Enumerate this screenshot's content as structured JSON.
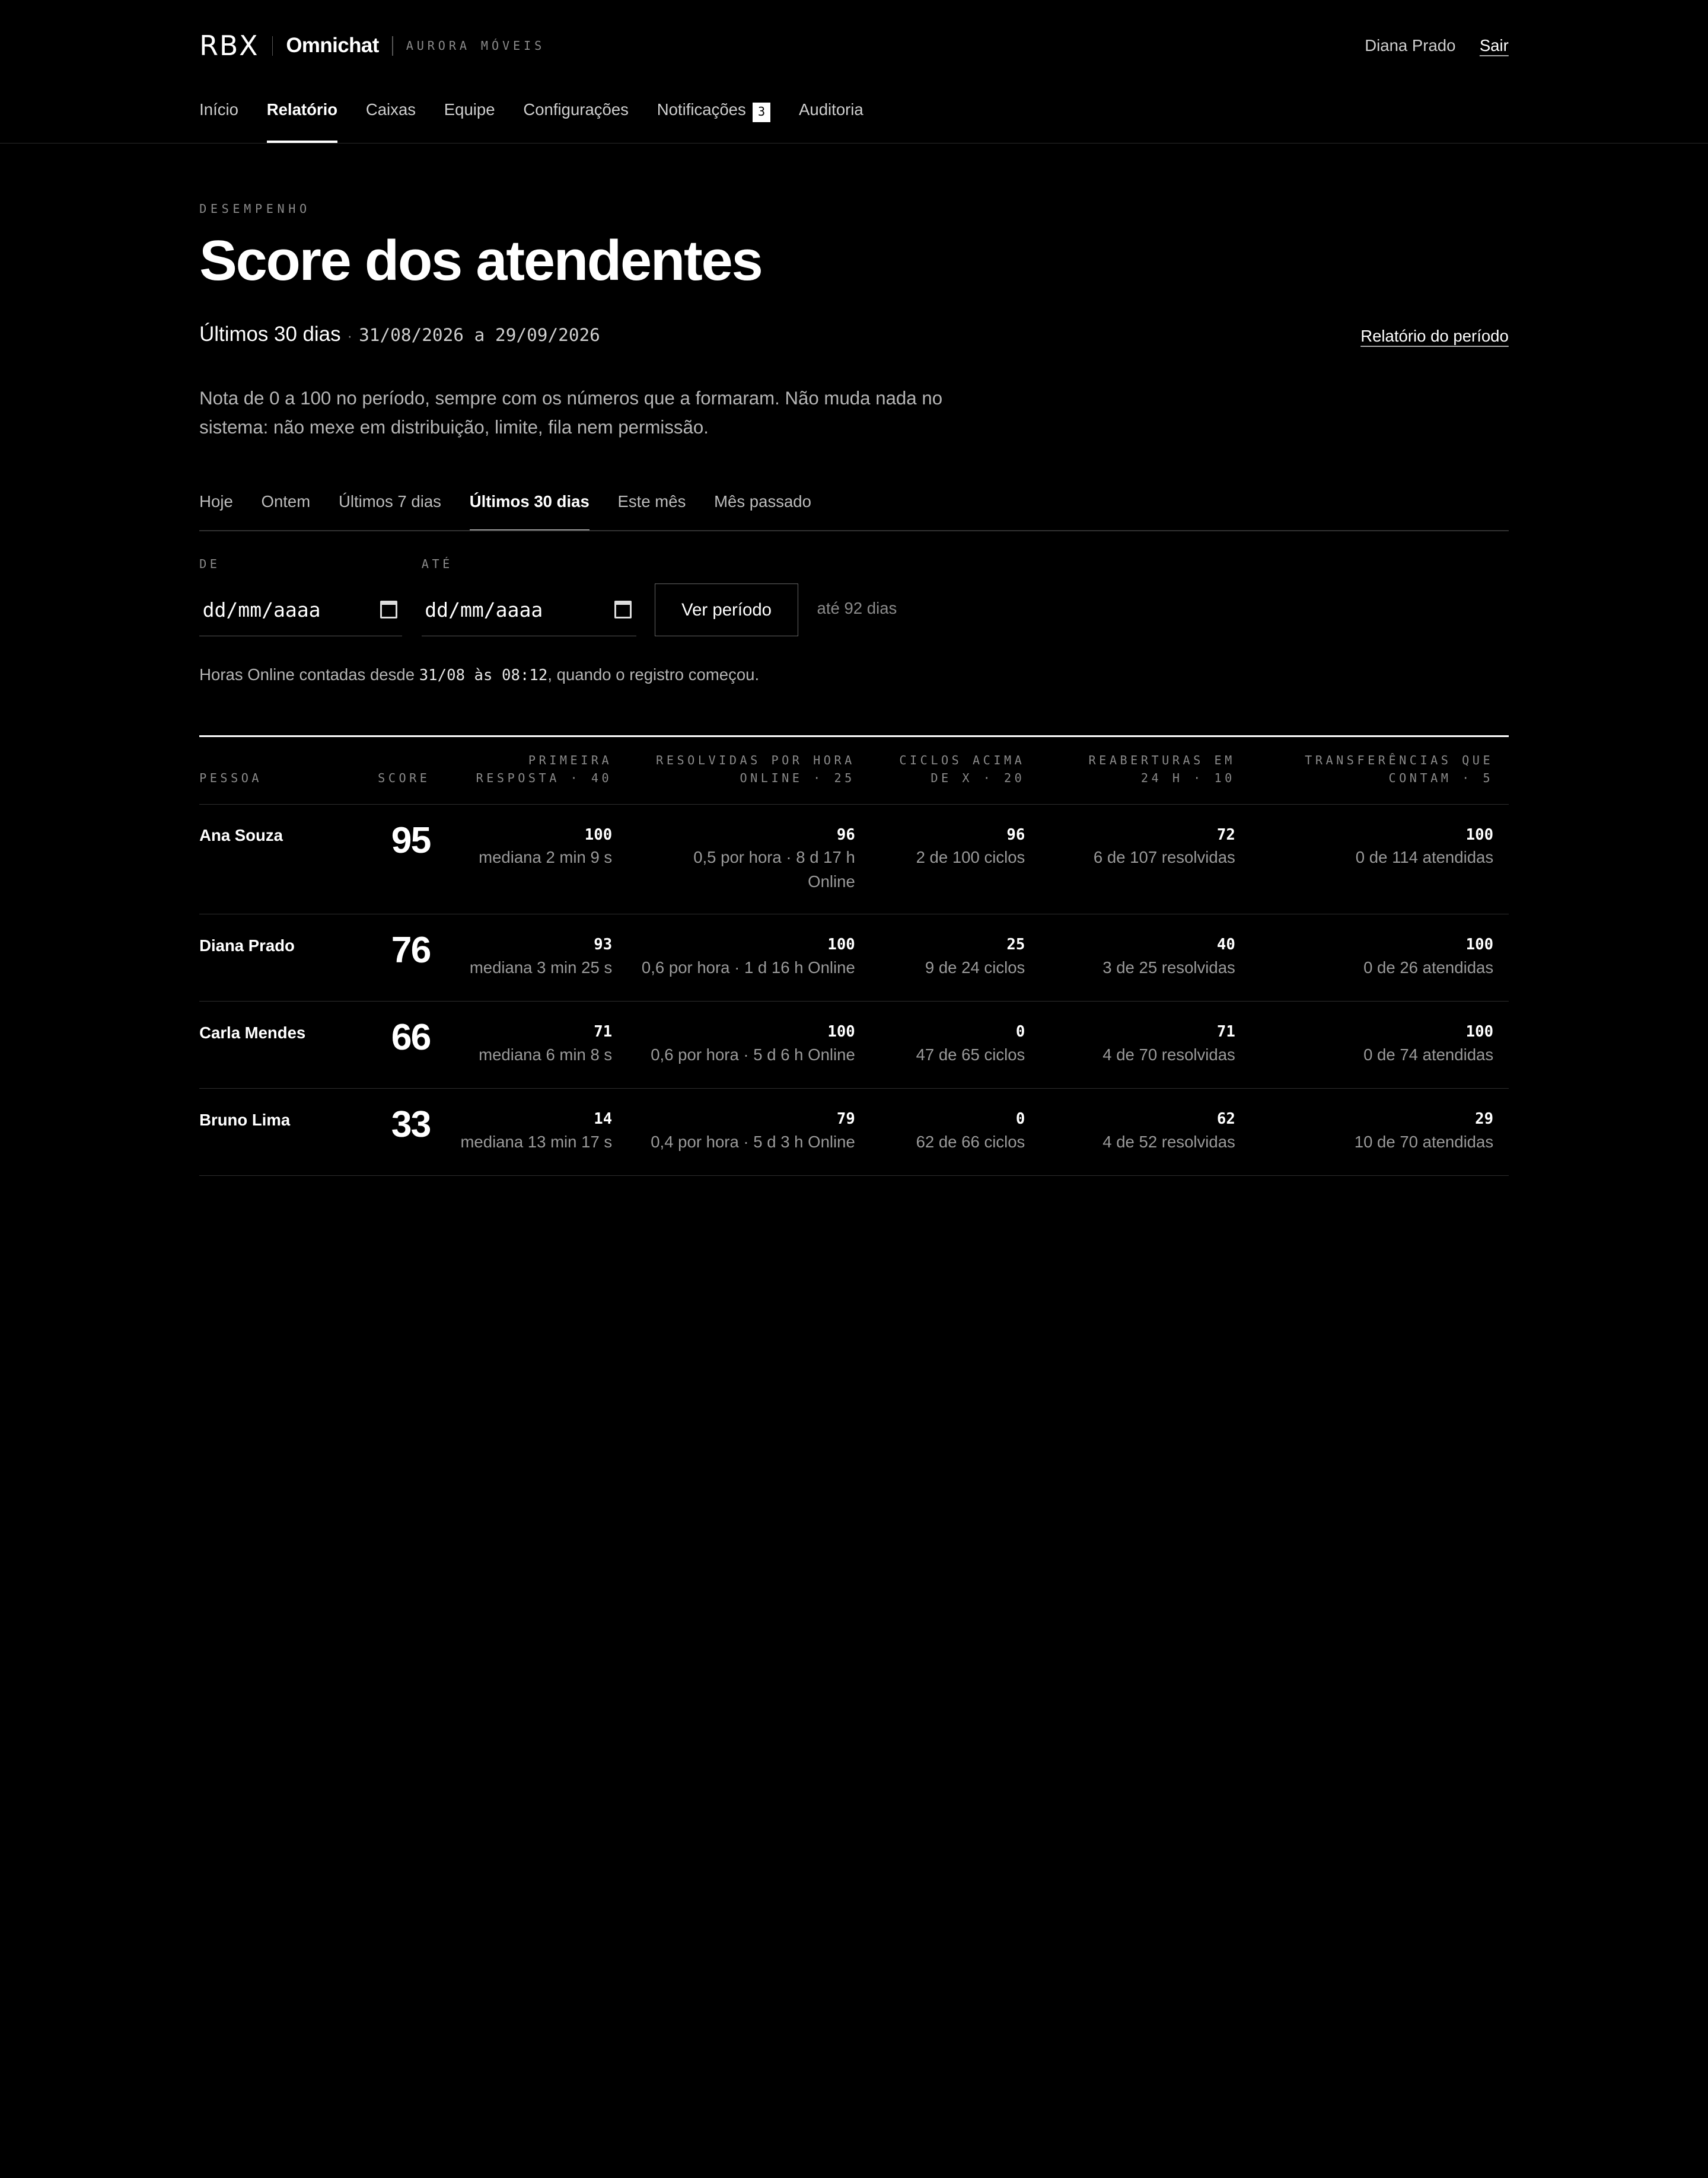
{
  "header": {
    "logo": "RBX",
    "product": "Omnichat",
    "company": "AURORA MÓVEIS",
    "user": "Diana Prado",
    "logout": "Sair"
  },
  "nav": [
    {
      "label": "Início"
    },
    {
      "label": "Relatório",
      "active": true
    },
    {
      "label": "Caixas"
    },
    {
      "label": "Equipe"
    },
    {
      "label": "Configurações"
    },
    {
      "label": "Notificações",
      "badge": "3"
    },
    {
      "label": "Auditoria"
    }
  ],
  "page": {
    "kicker": "DESEMPENHO",
    "title": "Score dos atendentes",
    "period_label": "Últimos 30 dias",
    "period_sep": "·",
    "period_range": "31/08/2026 a 29/09/2026",
    "report_link": "Relatório do período",
    "description": "Nota de 0 a 100 no período, sempre com os números que a formaram. Não muda nada no sistema: não mexe em distribuição, limite, fila nem permissão."
  },
  "range_tabs": [
    {
      "label": "Hoje"
    },
    {
      "label": "Ontem"
    },
    {
      "label": "Últimos 7 dias"
    },
    {
      "label": "Últimos 30 dias",
      "active": true
    },
    {
      "label": "Este mês"
    },
    {
      "label": "Mês passado"
    }
  ],
  "filters": {
    "from_label": "DE",
    "from_placeholder": "dd/mm/aaaa",
    "to_label": "ATÉ",
    "to_placeholder": "dd/mm/aaaa",
    "button": "Ver período",
    "hint": "até 92 dias"
  },
  "online_note": {
    "prefix": "Horas Online contadas desde ",
    "time": "31/08 às 08:12",
    "suffix": ", quando o registro começou."
  },
  "table": {
    "headers": {
      "person": "PESSOA",
      "score": "SCORE",
      "first_response": [
        "PRIMEIRA",
        "RESPOSTA · 40"
      ],
      "resolved": [
        "RESOLVIDAS POR HORA",
        "ONLINE · 25"
      ],
      "cycles": [
        "CICLOS ACIMA",
        "DE X · 20"
      ],
      "reopens": [
        "REABERTURAS EM",
        "24 H · 10"
      ],
      "transfers": [
        "TRANSFERÊNCIAS QUE",
        "CONTAM · 5"
      ]
    },
    "rows": [
      {
        "name": "Ana Souza",
        "score": "95",
        "first_response": {
          "value": "100",
          "detail": "mediana 2 min 9 s"
        },
        "resolved": {
          "value": "96",
          "detail": [
            "0,5 por hora · 8 d 17 h",
            "Online"
          ]
        },
        "cycles": {
          "value": "96",
          "detail": "2 de 100 ciclos"
        },
        "reopens": {
          "value": "72",
          "detail": "6 de 107 resolvidas"
        },
        "transfers": {
          "value": "100",
          "detail": "0 de 114 atendidas"
        }
      },
      {
        "name": "Diana Prado",
        "score": "76",
        "first_response": {
          "value": "93",
          "detail": "mediana 3 min 25 s"
        },
        "resolved": {
          "value": "100",
          "detail": [
            "0,6 por hora · 1 d 16 h Online"
          ]
        },
        "cycles": {
          "value": "25",
          "detail": "9 de 24 ciclos"
        },
        "reopens": {
          "value": "40",
          "detail": "3 de 25 resolvidas"
        },
        "transfers": {
          "value": "100",
          "detail": "0 de 26 atendidas"
        }
      },
      {
        "name": "Carla Mendes",
        "score": "66",
        "first_response": {
          "value": "71",
          "detail": "mediana 6 min 8 s"
        },
        "resolved": {
          "value": "100",
          "detail": [
            "0,6 por hora · 5 d 6 h Online"
          ]
        },
        "cycles": {
          "value": "0",
          "detail": "47 de 65 ciclos"
        },
        "reopens": {
          "value": "71",
          "detail": "4 de 70 resolvidas"
        },
        "transfers": {
          "value": "100",
          "detail": "0 de 74 atendidas"
        }
      },
      {
        "name": "Bruno Lima",
        "score": "33",
        "first_response": {
          "value": "14",
          "detail": "mediana 13 min 17 s"
        },
        "resolved": {
          "value": "79",
          "detail": [
            "0,4 por hora · 5 d 3 h Online"
          ]
        },
        "cycles": {
          "value": "0",
          "detail": "62 de 66 ciclos"
        },
        "reopens": {
          "value": "62",
          "detail": "4 de 52 resolvidas"
        },
        "transfers": {
          "value": "29",
          "detail": "10 de 70 atendidas"
        }
      }
    ]
  }
}
